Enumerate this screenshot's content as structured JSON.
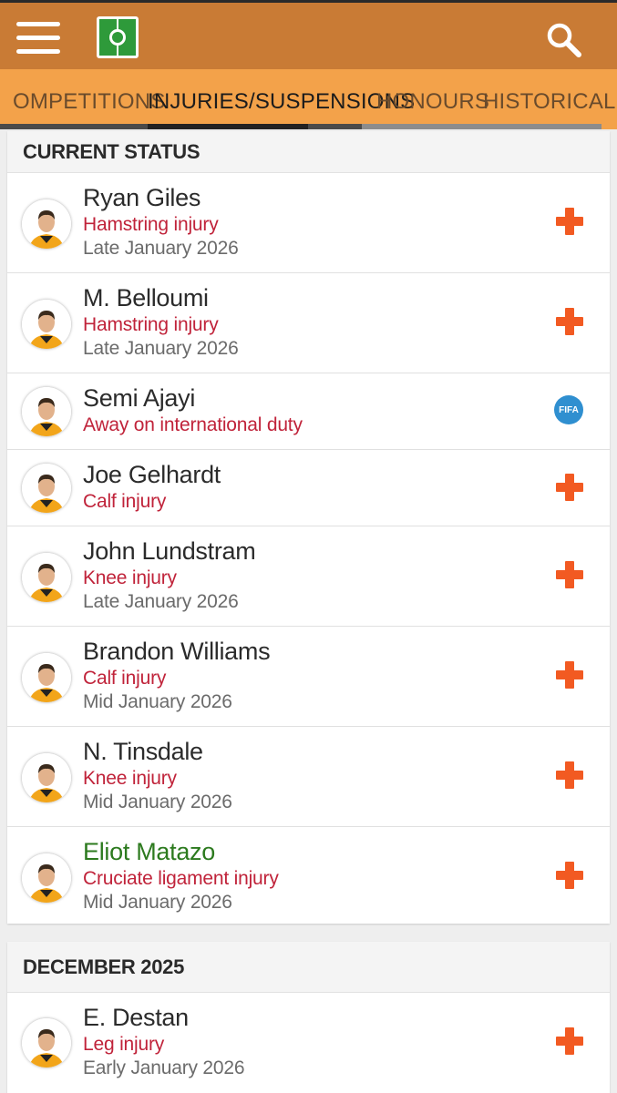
{
  "header": {
    "menu_icon": "hamburger-menu-icon",
    "logo_icon": "football-pitch-icon",
    "search_icon": "search-icon",
    "bg_color": "#c97b35"
  },
  "tabs": [
    {
      "label": "OMPETITIONS",
      "active": false
    },
    {
      "label": "INJURIES/SUSPENSIONS",
      "active": true
    },
    {
      "label": "HONOURS",
      "active": false
    },
    {
      "label": "HISTORICAL",
      "active": false
    }
  ],
  "sections": [
    {
      "title": "CURRENT STATUS",
      "players": [
        {
          "name": "Ryan Giles",
          "reason": "Hamstring injury",
          "return": "Late January 2026",
          "icon": "injury-cross-icon"
        },
        {
          "name": "M. Belloumi",
          "reason": "Hamstring injury",
          "return": "Late January 2026",
          "icon": "injury-cross-icon"
        },
        {
          "name": "Semi Ajayi",
          "reason": "Away on international duty",
          "return": "",
          "icon": "fifa-icon",
          "icon_text": "FIFA"
        },
        {
          "name": "Joe Gelhardt",
          "reason": "Calf injury",
          "return": "",
          "icon": "injury-cross-icon"
        },
        {
          "name": "John Lundstram",
          "reason": "Knee injury",
          "return": "Late January 2026",
          "icon": "injury-cross-icon"
        },
        {
          "name": "Brandon Williams",
          "reason": "Calf injury",
          "return": "Mid January 2026",
          "icon": "injury-cross-icon"
        },
        {
          "name": "N. Tinsdale",
          "reason": "Knee injury",
          "return": "Mid January 2026",
          "icon": "injury-cross-icon"
        },
        {
          "name": "Eliot Matazo",
          "reason": "Cruciate ligament injury",
          "return": "Mid January 2026",
          "icon": "injury-cross-icon",
          "highlight": true
        }
      ]
    },
    {
      "title": "DECEMBER 2025",
      "players": [
        {
          "name": "E. Destan",
          "reason": "Leg injury",
          "return": "Early January 2026",
          "icon": "injury-cross-icon"
        }
      ]
    }
  ]
}
